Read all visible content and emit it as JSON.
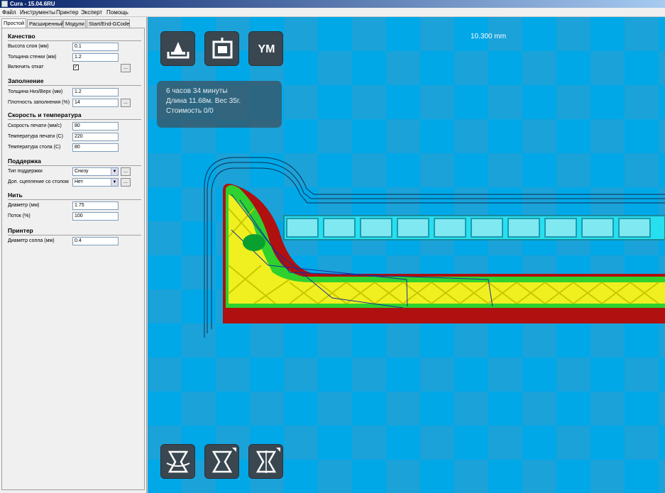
{
  "window": {
    "title": "Cura - 15.04.6RU"
  },
  "menu": [
    "Файл",
    "Инструменты",
    "Принтер",
    "Эксперт",
    "Помощь"
  ],
  "tabs": [
    "Простой",
    "Расширенный",
    "Модули",
    "Start/End-GCode"
  ],
  "sections": {
    "quality": {
      "title": "Качество",
      "layer_height_label": "Высота слоя (мм)",
      "layer_height": "0.1",
      "wall_label": "Толщина стенки (мм)",
      "wall": "1.2",
      "retraction_label": "Включить откат",
      "retraction_checked": "✓"
    },
    "fill": {
      "title": "Заполнение",
      "bottom_top_label": "Толщина Низ/Верх (мм)",
      "bottom_top": "1.2",
      "density_label": "Плотность заполнения (%)",
      "density": "14"
    },
    "speed": {
      "title": "Скорость и температура",
      "print_speed_label": "Скорость печати (мм/с)",
      "print_speed": "80",
      "print_temp_label": "Температура печати (C)",
      "print_temp": "220",
      "bed_temp_label": "Температура стола (C)",
      "bed_temp": "80"
    },
    "support": {
      "title": "Поддержка",
      "support_type_label": "Тип поддержки",
      "support_type": "Снизу",
      "adhesion_label": "Доп. сцепление со столом",
      "adhesion": "Нет"
    },
    "filament": {
      "title": "Нить",
      "diameter_label": "Диаметр (мм)",
      "diameter": "1.75",
      "flow_label": "Поток (%)",
      "flow": "100"
    },
    "machine": {
      "title": "Принтер",
      "nozzle_label": "Диаметр сопла (мм)",
      "nozzle": "0.4"
    }
  },
  "dots_label": "...",
  "viewport": {
    "height_readout": "10.300 mm",
    "ym_label": "YM",
    "print_time": "6 часов 34 минуты",
    "length_weight": "Длина 11.68м. Вес 35г.",
    "cost": "Стоимость 0/0"
  },
  "colors": {
    "background": "#1ba2d9",
    "checker": "#00a8e8",
    "button": "#3a4750",
    "wall_outer": "#b01010",
    "fill": "#f0f020"
  },
  "icons": [
    "load-model-icon",
    "printer-icon",
    "ym-view-icon",
    "rotate-icon",
    "scale-icon",
    "mirror-icon"
  ]
}
